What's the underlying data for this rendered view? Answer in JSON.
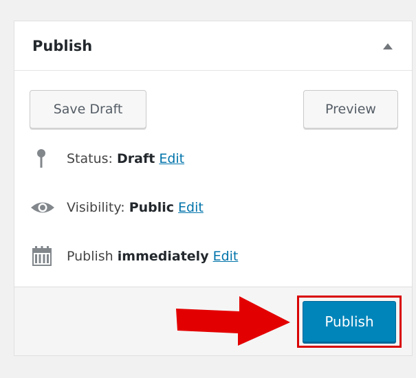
{
  "publish_box": {
    "title": "Publish",
    "save_draft_label": "Save Draft",
    "preview_label": "Preview",
    "status": {
      "icon": "pin-icon",
      "label": "Status:",
      "value": "Draft",
      "edit_label": "Edit"
    },
    "visibility": {
      "icon": "eye-icon",
      "label": "Visibility:",
      "value": "Public",
      "edit_label": "Edit"
    },
    "schedule": {
      "icon": "calendar-icon",
      "label": "Publish",
      "value": "immediately",
      "edit_label": "Edit"
    },
    "publish_button_label": "Publish"
  },
  "colors": {
    "primary_button": "#0085ba",
    "link": "#0073aa",
    "annotation": "#d90000"
  }
}
